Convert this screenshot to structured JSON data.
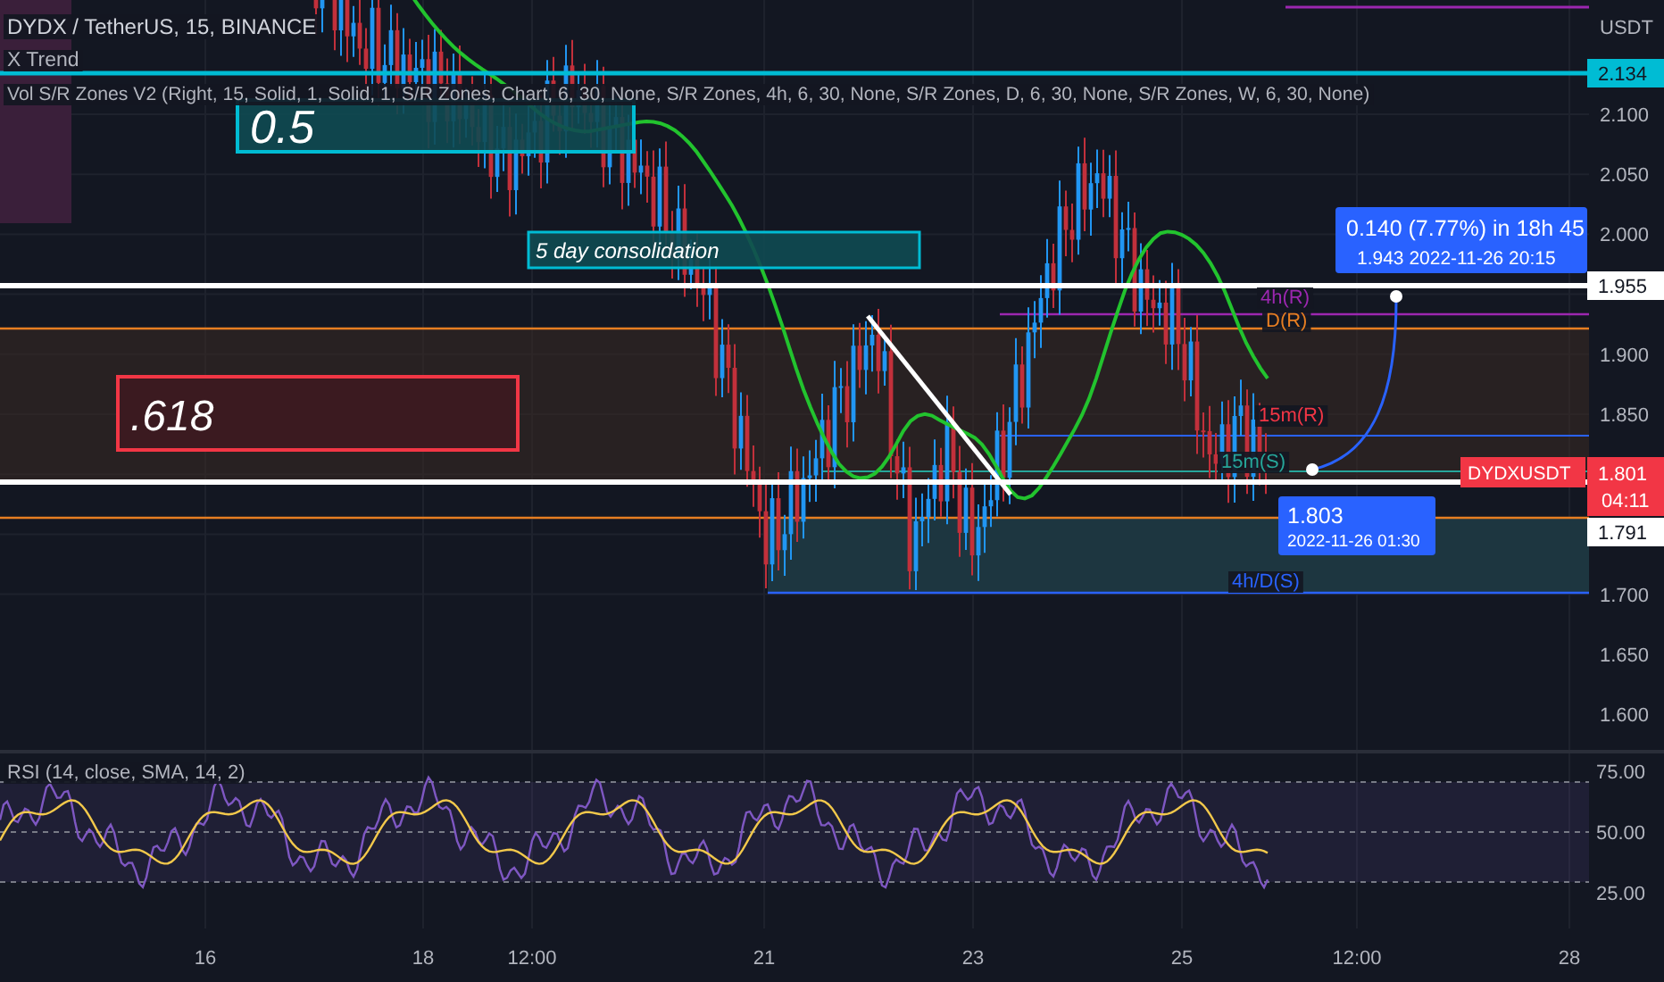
{
  "legend": {
    "symbol": "DYDX / TetherUS, 15, BINANCE",
    "indicators": [
      "X Trend",
      "Vol S/R Zones V2 (Right, 15, Solid, 1, Solid, 1, S/R Zones, Chart, 6, 30, None, S/R Zones, 4h, 6, 30, None, S/R Zones, D, 6, 30, None, S/R Zones, W, 6, 30, None)"
    ]
  },
  "annotations": [
    {
      "kind": "fib",
      "text": "0.5",
      "color": "#00bcd4"
    },
    {
      "kind": "note",
      "text": "5 day consolidation",
      "color": "#00bcd4"
    },
    {
      "kind": "fib",
      "text": ".618",
      "color": "#f23645"
    }
  ],
  "zone_labels": [
    {
      "text": "4h(R)",
      "color": "#9c27b0"
    },
    {
      "text": "D(R)",
      "color": "#e67e22"
    },
    {
      "text": "15m(R)",
      "color": "#f23645"
    },
    {
      "text": "15m(S)",
      "color": "#26a69a"
    },
    {
      "text": "4h/D(S)",
      "color": "#2962ff"
    }
  ],
  "measure": {
    "change": "0.140 (7.77%) in 18h 45",
    "target": "1.943",
    "target_time": "2022-11-26  20:15",
    "start_price": "1.803",
    "start_time": "2022-11-26 01:30"
  },
  "price_axis": {
    "currency": "USDT",
    "ticks": [
      "2.100",
      "2.050",
      "2.000",
      "1.900",
      "1.850",
      "1.700",
      "1.650",
      "1.600"
    ],
    "badges": [
      {
        "kind": "line",
        "price": "2.134",
        "color": "#00bcd4"
      },
      {
        "kind": "line",
        "price": "1.955",
        "color": "#ffffff"
      },
      {
        "kind": "last",
        "symbol": "DYDXUSDT",
        "price": "1.801",
        "countdown": "04:11",
        "color": "#f23645"
      },
      {
        "kind": "line",
        "price": "1.791",
        "color": "#ffffff"
      }
    ]
  },
  "rsi": {
    "legend": "RSI (14, close, SMA, 14, 2)",
    "ticks": [
      "75.00",
      "50.00",
      "25.00"
    ]
  },
  "time_axis": [
    "16",
    "18",
    "12:00",
    "21",
    "23",
    "25",
    "12:00",
    "28"
  ]
}
